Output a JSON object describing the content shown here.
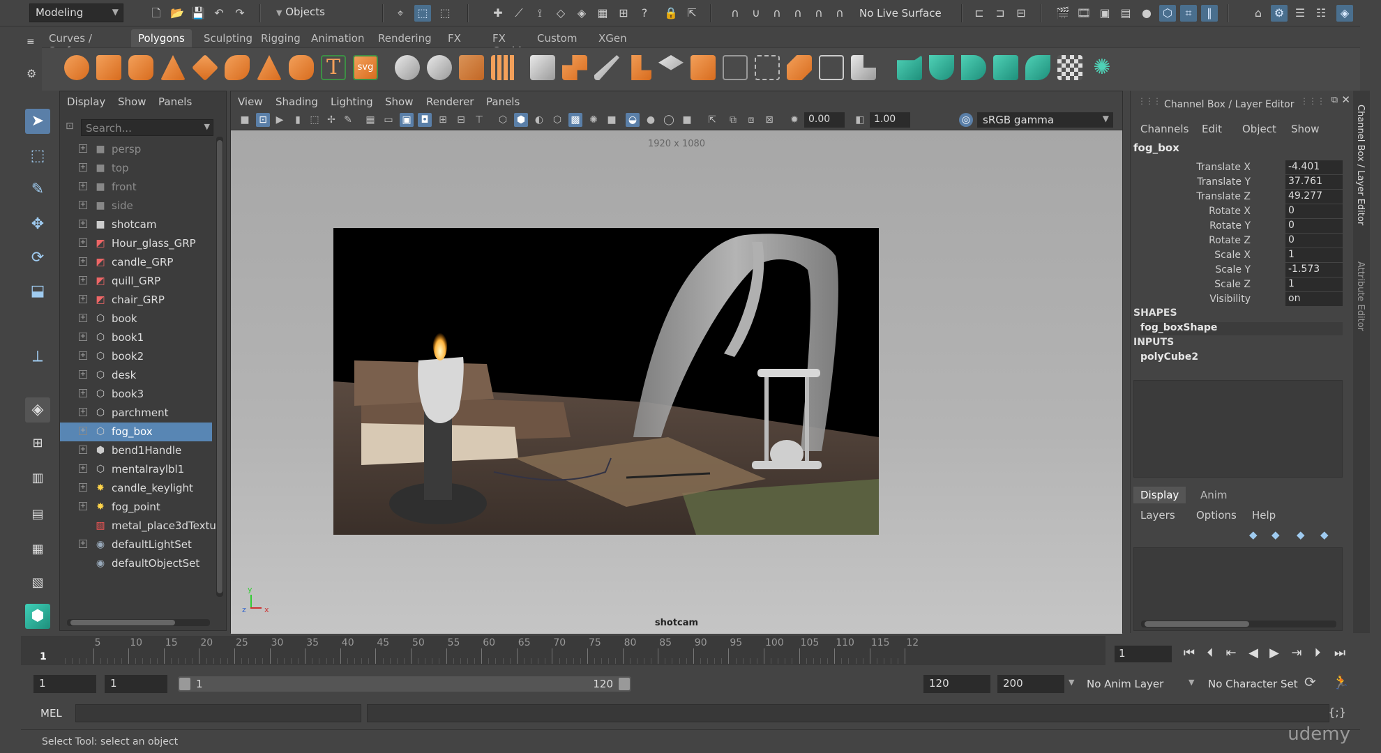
{
  "statusline": {
    "mode": "Modeling",
    "objects_label": "Objects",
    "live_surface": "No Live Surface"
  },
  "shelf": {
    "tabs": [
      "Curves / Surfaces",
      "Polygons",
      "Sculpting",
      "Rigging",
      "Animation",
      "Rendering",
      "FX",
      "FX Caching",
      "Custom",
      "XGen"
    ],
    "active_tab": "Polygons"
  },
  "outliner": {
    "menu": [
      "Display",
      "Show",
      "Panels"
    ],
    "search_placeholder": "Search...",
    "items": [
      {
        "label": "persp",
        "icon": "camera-icon",
        "dim": true
      },
      {
        "label": "top",
        "icon": "camera-icon",
        "dim": true
      },
      {
        "label": "front",
        "icon": "camera-icon",
        "dim": true
      },
      {
        "label": "side",
        "icon": "camera-icon",
        "dim": true
      },
      {
        "label": "shotcam",
        "icon": "camera-icon",
        "dim": false
      },
      {
        "label": "Hour_glass_GRP",
        "icon": "group-icon",
        "dim": false
      },
      {
        "label": "candle_GRP",
        "icon": "group-icon",
        "dim": false
      },
      {
        "label": "quill_GRP",
        "icon": "group-icon",
        "dim": false
      },
      {
        "label": "chair_GRP",
        "icon": "group-icon",
        "dim": false
      },
      {
        "label": "book",
        "icon": "mesh-icon",
        "dim": false
      },
      {
        "label": "book1",
        "icon": "mesh-icon",
        "dim": false
      },
      {
        "label": "book2",
        "icon": "mesh-icon",
        "dim": false
      },
      {
        "label": "desk",
        "icon": "mesh-icon",
        "dim": false
      },
      {
        "label": "book3",
        "icon": "mesh-icon",
        "dim": false
      },
      {
        "label": "parchment",
        "icon": "mesh-icon",
        "dim": false
      },
      {
        "label": "fog_box",
        "icon": "mesh-icon",
        "dim": false,
        "selected": true
      },
      {
        "label": "bend1Handle",
        "icon": "deformer-icon",
        "dim": false
      },
      {
        "label": "mentalraylbl1",
        "icon": "mesh-icon",
        "dim": false
      },
      {
        "label": "candle_keylight",
        "icon": "light-icon",
        "dim": false
      },
      {
        "label": "fog_point",
        "icon": "light-icon",
        "dim": false
      },
      {
        "label": "metal_place3dTextu",
        "icon": "texture-icon",
        "dim": false
      },
      {
        "label": "defaultLightSet",
        "icon": "set-icon",
        "dim": false
      },
      {
        "label": "defaultObjectSet",
        "icon": "set-icon",
        "dim": false
      }
    ]
  },
  "viewport": {
    "menu": [
      "View",
      "Shading",
      "Lighting",
      "Show",
      "Renderer",
      "Panels"
    ],
    "exposure": "0.00",
    "gamma_value": "1.00",
    "color_space": "sRGB gamma",
    "resolution": "1920 x 1080",
    "camera": "shotcam",
    "axis_x": "x",
    "axis_y": "y",
    "axis_z": "z"
  },
  "channel_box": {
    "title": "Channel Box / Layer Editor",
    "menu": [
      "Channels",
      "Edit",
      "Object",
      "Show"
    ],
    "object": "fog_box",
    "attributes": [
      {
        "name": "Translate X",
        "value": "-4.401"
      },
      {
        "name": "Translate Y",
        "value": "37.761"
      },
      {
        "name": "Translate Z",
        "value": "49.277"
      },
      {
        "name": "Rotate X",
        "value": "0"
      },
      {
        "name": "Rotate Y",
        "value": "0"
      },
      {
        "name": "Rotate Z",
        "value": "0"
      },
      {
        "name": "Scale X",
        "value": "1"
      },
      {
        "name": "Scale Y",
        "value": "-1.573"
      },
      {
        "name": "Scale Z",
        "value": "1"
      },
      {
        "name": "Visibility",
        "value": "on"
      }
    ],
    "shapes_label": "SHAPES",
    "shape": "fog_boxShape",
    "inputs_label": "INPUTS",
    "input": "polyCube2",
    "layer_tabs": [
      "Display",
      "Anim"
    ],
    "active_layer_tab": "Display",
    "layer_menu": [
      "Layers",
      "Options",
      "Help"
    ]
  },
  "side_tabs": [
    "Channel Box / Layer Editor",
    "Attribute Editor"
  ],
  "timeline": {
    "ticks": [
      "5",
      "10",
      "15",
      "20",
      "25",
      "30",
      "35",
      "40",
      "45",
      "50",
      "55",
      "60",
      "65",
      "70",
      "75",
      "80",
      "85",
      "90",
      "95",
      "100",
      "105",
      "110",
      "115",
      "12"
    ],
    "start_frame_label": "1",
    "current_frame": "1"
  },
  "range": {
    "start": "1",
    "playback_start": "1",
    "slider_start": "1",
    "slider_end": "120",
    "playback_end": "120",
    "end": "200",
    "anim_layer": "No Anim Layer",
    "character_set": "No Character Set"
  },
  "command": {
    "language": "MEL"
  },
  "help_line": "Select Tool: select an object",
  "watermark": "udemy"
}
